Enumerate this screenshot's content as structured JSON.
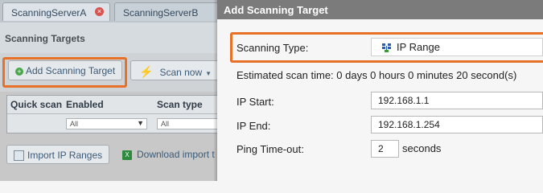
{
  "tabs": [
    {
      "label": "ScanningServerA",
      "close": "×"
    },
    {
      "label": "ScanningServerB"
    }
  ],
  "section_title": "Scanning Targets",
  "toolbar": {
    "add_target": "Add Scanning Target",
    "scan_now": "Scan now"
  },
  "grid": {
    "columns": [
      "Quick scan",
      "Enabled",
      "Scan type"
    ],
    "filters": [
      "All",
      "All"
    ]
  },
  "bottom": {
    "import": "Import IP Ranges",
    "download": "Download import t"
  },
  "dialog": {
    "title": "Add Scanning Target",
    "scanning_type_label": "Scanning Type:",
    "scanning_type_value": "IP Range",
    "estimate": "Estimated scan time: 0 days 0 hours 0 minutes 20 second(s)",
    "ip_start_label": "IP Start:",
    "ip_start_value": "192.168.1.1",
    "ip_end_label": "IP End:",
    "ip_end_value": "192.168.1.254",
    "ping_label": "Ping Time-out:",
    "ping_value": "2",
    "ping_unit": "seconds"
  },
  "colors": {
    "highlight": "#e8712a",
    "dialog_header": "#7b7b7b"
  }
}
